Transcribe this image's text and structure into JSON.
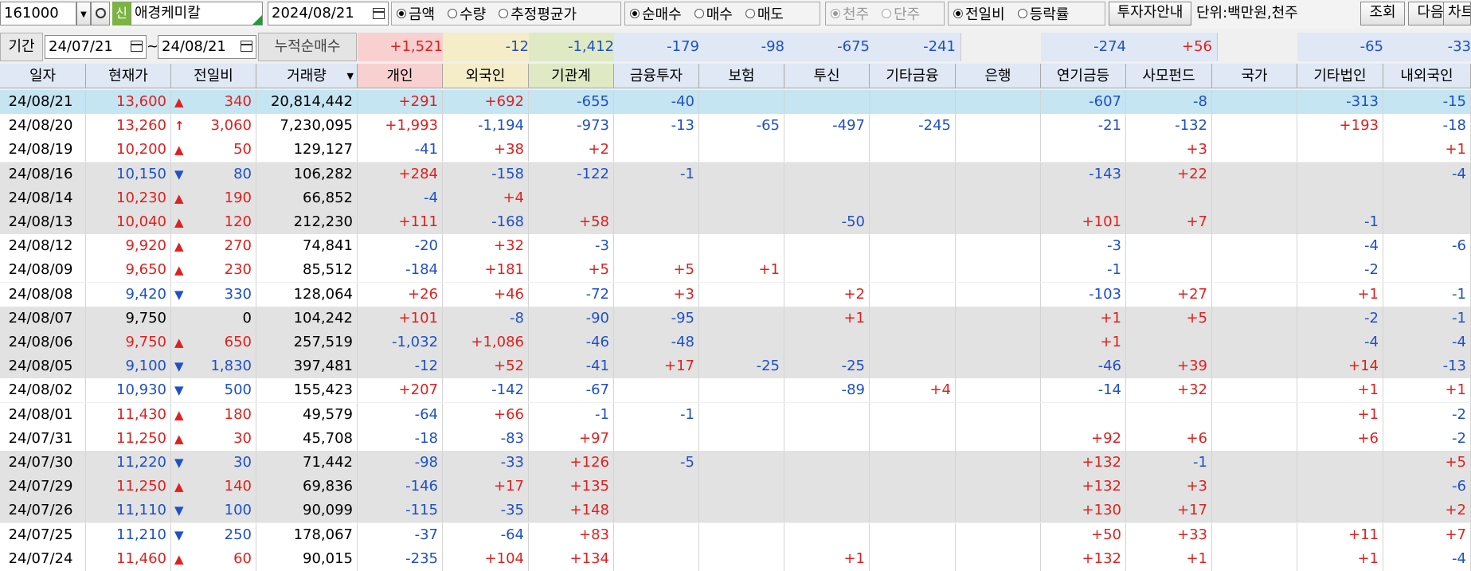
{
  "toolbar": {
    "code": "161000",
    "new_badge": "신",
    "stock_name": "애경케미칼",
    "date": "2024/08/21",
    "group1": [
      {
        "label": "금액",
        "on": true
      },
      {
        "label": "수량",
        "on": false
      },
      {
        "label": "추정평균가",
        "on": false
      }
    ],
    "group2": [
      {
        "label": "순매수",
        "on": true
      },
      {
        "label": "매수",
        "on": false
      },
      {
        "label": "매도",
        "on": false
      }
    ],
    "group3": [
      {
        "label": "천주",
        "on": true
      },
      {
        "label": "단주",
        "on": false
      }
    ],
    "group4": [
      {
        "label": "전일비",
        "on": true
      },
      {
        "label": "등락률",
        "on": false
      }
    ],
    "investor_guide": "투자자안내",
    "unit": "단위:백만원,천주",
    "query": "조회",
    "next": "다음",
    "chart": "차트"
  },
  "period": {
    "label": "기간",
    "from": "24/07/21",
    "sep": "~",
    "to": "24/08/21",
    "cum_label": "누적순매수",
    "cum": [
      "+1,521",
      "-12",
      "-1,412",
      "-179",
      "-98",
      "-675",
      "-241",
      "",
      "-274",
      "+56",
      "",
      "-65",
      "-33"
    ]
  },
  "table": {
    "headers": [
      "일자",
      "현재가",
      "전일비",
      "거래량",
      "개인",
      "외국인",
      "기관계",
      "금융투자",
      "보험",
      "투신",
      "기타금융",
      "은행",
      "연기금등",
      "사모펀드",
      "국가",
      "기타법인",
      "내외국인"
    ],
    "rows": [
      {
        "date": "24/08/21",
        "price": "13,600",
        "dir": "up",
        "change": "340",
        "volume": "20,814,442",
        "v": [
          "+291",
          "+692",
          "-655",
          "-40",
          "",
          "",
          "",
          "",
          "-607",
          "-8",
          "",
          "-313",
          "-15"
        ]
      },
      {
        "date": "24/08/20",
        "price": "13,260",
        "dir": "limit",
        "change": "3,060",
        "volume": "7,230,095",
        "v": [
          "+1,993",
          "-1,194",
          "-973",
          "-13",
          "-65",
          "-497",
          "-245",
          "",
          "-21",
          "-132",
          "",
          "+193",
          "-18"
        ]
      },
      {
        "date": "24/08/19",
        "price": "10,200",
        "dir": "up",
        "change": "50",
        "volume": "129,127",
        "v": [
          "-41",
          "+38",
          "+2",
          "",
          "",
          "",
          "",
          "",
          "",
          "+3",
          "",
          "",
          "+1"
        ]
      },
      {
        "date": "24/08/16",
        "price": "10,150",
        "dir": "down",
        "change": "80",
        "volume": "106,282",
        "v": [
          "+284",
          "-158",
          "-122",
          "-1",
          "",
          "",
          "",
          "",
          "-143",
          "+22",
          "",
          "",
          "-4"
        ]
      },
      {
        "date": "24/08/14",
        "price": "10,230",
        "dir": "up",
        "change": "190",
        "volume": "66,852",
        "v": [
          "-4",
          "+4",
          "",
          "",
          "",
          "",
          "",
          "",
          "",
          "",
          "",
          "",
          ""
        ]
      },
      {
        "date": "24/08/13",
        "price": "10,040",
        "dir": "up",
        "change": "120",
        "volume": "212,230",
        "v": [
          "+111",
          "-168",
          "+58",
          "",
          "",
          "-50",
          "",
          "",
          "+101",
          "+7",
          "",
          "-1",
          ""
        ]
      },
      {
        "date": "24/08/12",
        "price": "9,920",
        "dir": "up",
        "change": "270",
        "volume": "74,841",
        "v": [
          "-20",
          "+32",
          "-3",
          "",
          "",
          "",
          "",
          "",
          "-3",
          "",
          "",
          "-4",
          "-6"
        ]
      },
      {
        "date": "24/08/09",
        "price": "9,650",
        "dir": "up",
        "change": "230",
        "volume": "85,512",
        "v": [
          "-184",
          "+181",
          "+5",
          "+5",
          "+1",
          "",
          "",
          "",
          "-1",
          "",
          "",
          "-2",
          ""
        ]
      },
      {
        "date": "24/08/08",
        "price": "9,420",
        "dir": "down",
        "change": "330",
        "volume": "128,064",
        "v": [
          "+26",
          "+46",
          "-72",
          "+3",
          "",
          "+2",
          "",
          "",
          "-103",
          "+27",
          "",
          "+1",
          "-1"
        ]
      },
      {
        "date": "24/08/07",
        "price": "9,750",
        "dir": "none",
        "change": "0",
        "volume": "104,242",
        "v": [
          "+101",
          "-8",
          "-90",
          "-95",
          "",
          "+1",
          "",
          "",
          "+1",
          "+5",
          "",
          "-2",
          "-1"
        ]
      },
      {
        "date": "24/08/06",
        "price": "9,750",
        "dir": "up",
        "change": "650",
        "volume": "257,519",
        "v": [
          "-1,032",
          "+1,086",
          "-46",
          "-48",
          "",
          "",
          "",
          "",
          "+1",
          "",
          "",
          "-4",
          "-4"
        ]
      },
      {
        "date": "24/08/05",
        "price": "9,100",
        "dir": "down",
        "change": "1,830",
        "volume": "397,481",
        "v": [
          "-12",
          "+52",
          "-41",
          "+17",
          "-25",
          "-25",
          "",
          "",
          "-46",
          "+39",
          "",
          "+14",
          "-13"
        ]
      },
      {
        "date": "24/08/02",
        "price": "10,930",
        "dir": "down",
        "change": "500",
        "volume": "155,423",
        "v": [
          "+207",
          "-142",
          "-67",
          "",
          "",
          "-89",
          "+4",
          "",
          "-14",
          "+32",
          "",
          "+1",
          "+1"
        ]
      },
      {
        "date": "24/08/01",
        "price": "11,430",
        "dir": "up",
        "change": "180",
        "volume": "49,579",
        "v": [
          "-64",
          "+66",
          "-1",
          "-1",
          "",
          "",
          "",
          "",
          "",
          "",
          "",
          "+1",
          "-2"
        ]
      },
      {
        "date": "24/07/31",
        "price": "11,250",
        "dir": "up",
        "change": "30",
        "volume": "45,708",
        "v": [
          "-18",
          "-83",
          "+97",
          "",
          "",
          "",
          "",
          "",
          "+92",
          "+6",
          "",
          "+6",
          "-2"
        ]
      },
      {
        "date": "24/07/30",
        "price": "11,220",
        "dir": "down",
        "change": "30",
        "volume": "71,442",
        "v": [
          "-98",
          "-33",
          "+126",
          "-5",
          "",
          "",
          "",
          "",
          "+132",
          "-1",
          "",
          "",
          "+5"
        ]
      },
      {
        "date": "24/07/29",
        "price": "11,250",
        "dir": "up",
        "change": "140",
        "volume": "69,836",
        "v": [
          "-146",
          "+17",
          "+135",
          "",
          "",
          "",
          "",
          "",
          "+132",
          "+3",
          "",
          "",
          "-6"
        ]
      },
      {
        "date": "24/07/26",
        "price": "11,110",
        "dir": "down",
        "change": "100",
        "volume": "90,099",
        "v": [
          "-115",
          "-35",
          "+148",
          "",
          "",
          "",
          "",
          "",
          "+130",
          "+17",
          "",
          "",
          "+2"
        ]
      },
      {
        "date": "24/07/25",
        "price": "11,210",
        "dir": "down",
        "change": "250",
        "volume": "178,067",
        "v": [
          "-37",
          "-64",
          "+83",
          "",
          "",
          "",
          "",
          "",
          "+50",
          "+33",
          "",
          "+11",
          "+7"
        ]
      },
      {
        "date": "24/07/24",
        "price": "11,460",
        "dir": "up",
        "change": "60",
        "volume": "90,015",
        "v": [
          "-235",
          "+104",
          "+134",
          "",
          "",
          "+1",
          "",
          "",
          "+132",
          "+1",
          "",
          "+1",
          "-4"
        ]
      }
    ]
  },
  "colors": {
    "up": "#e0201e",
    "down": "#1e50c8",
    "selected_row": "#c5e5f2",
    "gray_row": "#e2e2e2",
    "header_individual": "#f8d0d0",
    "header_foreign": "#f5ecc8",
    "header_institution": "#dfeac4",
    "header_default": "#dfe8f4"
  }
}
